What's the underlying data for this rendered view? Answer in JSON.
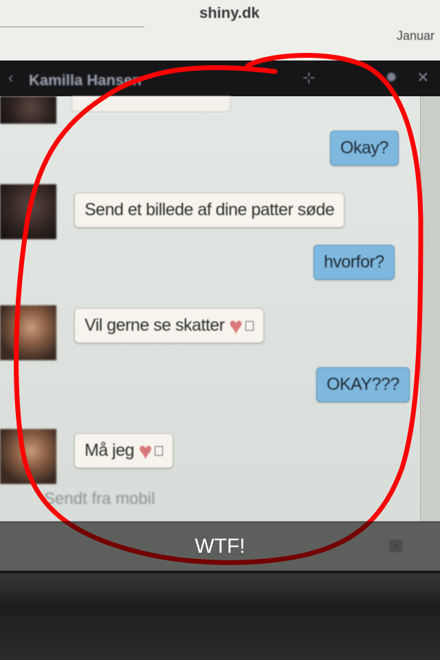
{
  "browser": {
    "site": "shiny.dk",
    "month": "Januar"
  },
  "chat": {
    "contact_name": "Kamilla Hansen",
    "messages": [
      {
        "from": "me",
        "text": "Okay?"
      },
      {
        "from": "them",
        "text": "Send et billede af dine patter søde"
      },
      {
        "from": "me",
        "text": "hvorfor?"
      },
      {
        "from": "them",
        "text": "Vil gerne se skatter"
      },
      {
        "from": "me",
        "text": "OKAY???"
      },
      {
        "from": "them",
        "text": "Må jeg"
      }
    ],
    "sent_note": "Sendt fra mobil"
  },
  "snap": {
    "caption": "WTF!",
    "doodle_color": "#ff0000"
  },
  "icons": [
    "add-friend-icon",
    "gear-icon",
    "close-icon",
    "heart-icon",
    "camera-icon"
  ]
}
